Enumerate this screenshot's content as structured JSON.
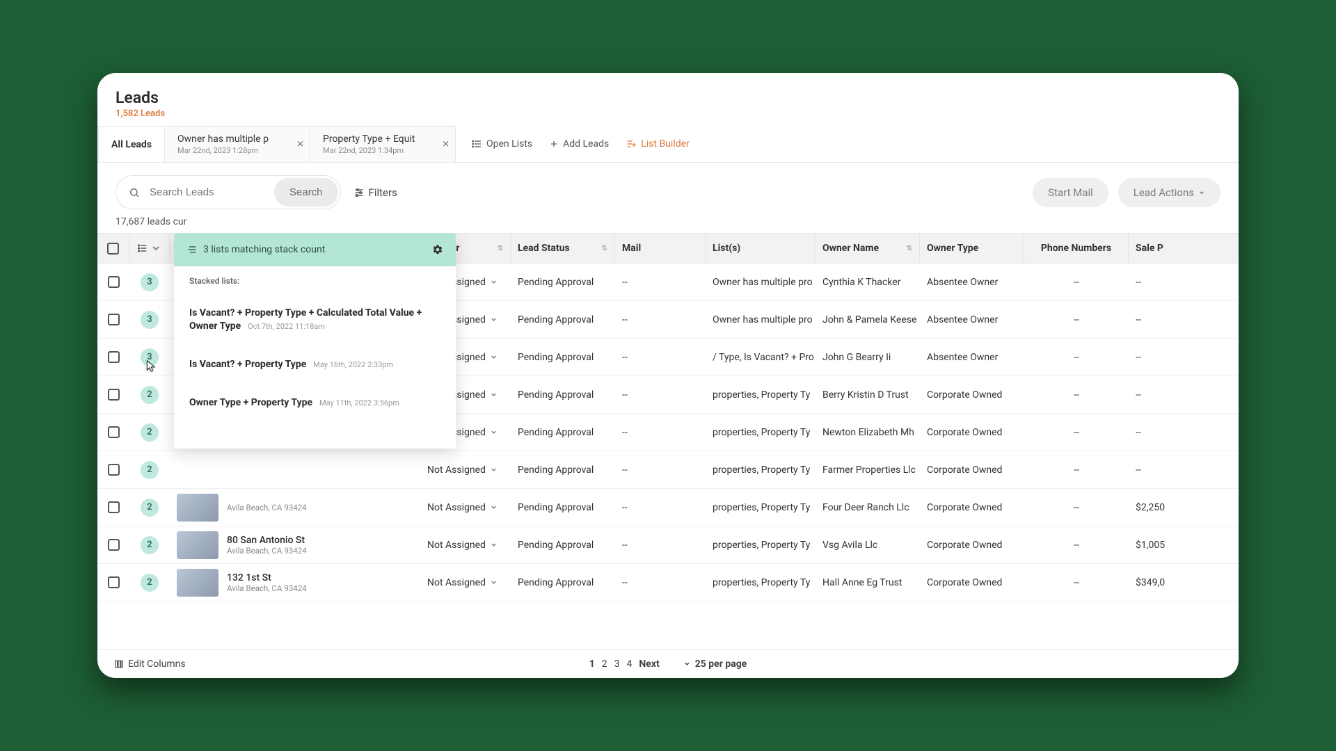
{
  "header": {
    "title": "Leads",
    "subtitle": "1,582 Leads"
  },
  "tabs": [
    {
      "label": "All Leads",
      "sub": "",
      "closable": false,
      "active": true
    },
    {
      "label": "Owner has multiple p",
      "sub": "Mar 22nd, 2023 1:28pm",
      "closable": true,
      "active": false
    },
    {
      "label": "Property Type + Equit",
      "sub": "Mar 22nd, 2023 1:34pm",
      "closable": true,
      "active": false
    }
  ],
  "tab_actions": {
    "open_lists": "Open Lists",
    "add_leads": "Add Leads",
    "list_builder": "List Builder"
  },
  "toolbar": {
    "search_placeholder": "Search Leads",
    "search_btn": "Search",
    "filters": "Filters",
    "start_mail": "Start Mail",
    "lead_actions": "Lead Actions"
  },
  "count_line": "17,687 leads cur",
  "columns": {
    "lead_owner": "Lead Owner",
    "lead_status": "Lead Status",
    "mail": "Mail",
    "lists": "List(s)",
    "owner_name": "Owner Name",
    "owner_type": "Owner Type",
    "phone": "Phone Numbers",
    "sale": "Sale P"
  },
  "rows": [
    {
      "stack": "3",
      "addr": "",
      "city": "",
      "lead_owner": "Not Assigned",
      "status": "Pending Approval",
      "mail": "--",
      "lists": "Owner has multiple pro",
      "owner_name": "Cynthia K Thacker",
      "owner_type": "Absentee Owner",
      "phone": "--",
      "sale": "--"
    },
    {
      "stack": "3",
      "addr": "",
      "city": "",
      "lead_owner": "Not Assigned",
      "status": "Pending Approval",
      "mail": "--",
      "lists": "Owner has multiple pro",
      "owner_name": "John & Pamela Keese",
      "owner_type": "Absentee Owner",
      "phone": "--",
      "sale": "--"
    },
    {
      "stack": "3",
      "addr": "",
      "city": "",
      "lead_owner": "Not Assigned",
      "status": "Pending Approval",
      "mail": "--",
      "lists": "/ Type, Is Vacant? + Pro",
      "owner_name": "John G Bearry Ii",
      "owner_type": "Absentee Owner",
      "phone": "--",
      "sale": "--"
    },
    {
      "stack": "2",
      "addr": "",
      "city": "",
      "lead_owner": "Not Assigned",
      "status": "Pending Approval",
      "mail": "--",
      "lists": "properties, Property Ty",
      "owner_name": "Berry Kristin D Trust",
      "owner_type": "Corporate Owned",
      "phone": "--",
      "sale": "--"
    },
    {
      "stack": "2",
      "addr": "",
      "city": "",
      "lead_owner": "Not Assigned",
      "status": "Pending Approval",
      "mail": "--",
      "lists": "properties, Property Ty",
      "owner_name": "Newton Elizabeth Mh",
      "owner_type": "Corporate Owned",
      "phone": "--",
      "sale": "--"
    },
    {
      "stack": "2",
      "addr": "",
      "city": "",
      "lead_owner": "Not Assigned",
      "status": "Pending Approval",
      "mail": "--",
      "lists": "properties, Property Ty",
      "owner_name": "Farmer Properties Llc",
      "owner_type": "Corporate Owned",
      "phone": "--",
      "sale": "--"
    },
    {
      "stack": "2",
      "addr": "",
      "city": "Avila Beach, CA 93424",
      "lead_owner": "Not Assigned",
      "status": "Pending Approval",
      "mail": "--",
      "lists": "properties, Property Ty",
      "owner_name": "Four Deer Ranch Llc",
      "owner_type": "Corporate Owned",
      "phone": "--",
      "sale": "$2,250"
    },
    {
      "stack": "2",
      "addr": "80 San Antonio St",
      "city": "Avila Beach, CA 93424",
      "lead_owner": "Not Assigned",
      "status": "Pending Approval",
      "mail": "--",
      "lists": "properties, Property Ty",
      "owner_name": "Vsg Avila Llc",
      "owner_type": "Corporate Owned",
      "phone": "--",
      "sale": "$1,005"
    },
    {
      "stack": "2",
      "addr": "132 1st St",
      "city": "Avila Beach, CA 93424",
      "lead_owner": "Not Assigned",
      "status": "Pending Approval",
      "mail": "--",
      "lists": "properties, Property Ty",
      "owner_name": "Hall Anne Eg Trust",
      "owner_type": "Corporate Owned",
      "phone": "--",
      "sale": "$349,0"
    }
  ],
  "popover": {
    "title": "3 lists matching stack count",
    "stacked_label": "Stacked lists:",
    "items": [
      {
        "name": "Is Vacant? + Property Type + Calculated Total Value + Owner Type",
        "date": "Oct 7th, 2022 11:18am"
      },
      {
        "name": "Is Vacant? + Property Type",
        "date": "May 16th, 2022 2:33pm"
      },
      {
        "name": "Owner Type + Property Type",
        "date": "May 11th, 2022 3:56pm"
      }
    ]
  },
  "footer": {
    "edit_columns": "Edit Columns",
    "pages": [
      "1",
      "2",
      "3",
      "4"
    ],
    "next": "Next",
    "per_page": "25 per page"
  }
}
